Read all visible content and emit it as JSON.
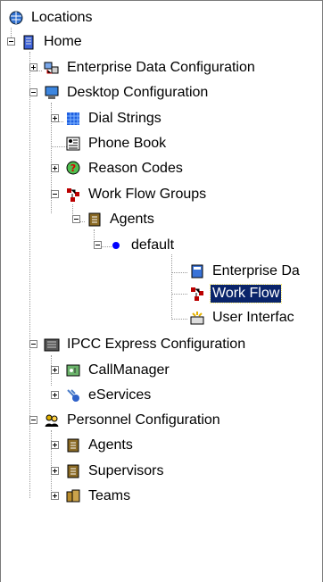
{
  "tree": {
    "root": "Locations",
    "home": "Home",
    "enterprise_data_configuration": "Enterprise Data Configuration",
    "desktop_configuration": "Desktop Configuration",
    "dial_strings": "Dial Strings",
    "phone_book": "Phone Book",
    "reason_codes": "Reason Codes",
    "work_flow_groups": "Work Flow Groups",
    "agents_group": "Agents",
    "default": "default",
    "enterprise_data_truncated": "Enterprise Da",
    "work_flow": "Work Flow",
    "user_interface_truncated": "User Interfac",
    "ipcc_express_configuration": "IPCC Express Configuration",
    "callmanager": "CallManager",
    "eservices": "eServices",
    "personnel_configuration": "Personnel Configuration",
    "agents": "Agents",
    "supervisors": "Supervisors",
    "teams": "Teams"
  },
  "selected_item": "Work Flow",
  "icons": {
    "root": "globe-icon",
    "home": "building-icon",
    "enterprise": "network-computer-icon",
    "desktop": "monitor-icon",
    "dial": "grid-icon",
    "phone": "address-book-icon",
    "reason": "question-icon",
    "workflow": "workflow-icon",
    "agents": "person-icon",
    "default": "blue-dot-icon"
  }
}
